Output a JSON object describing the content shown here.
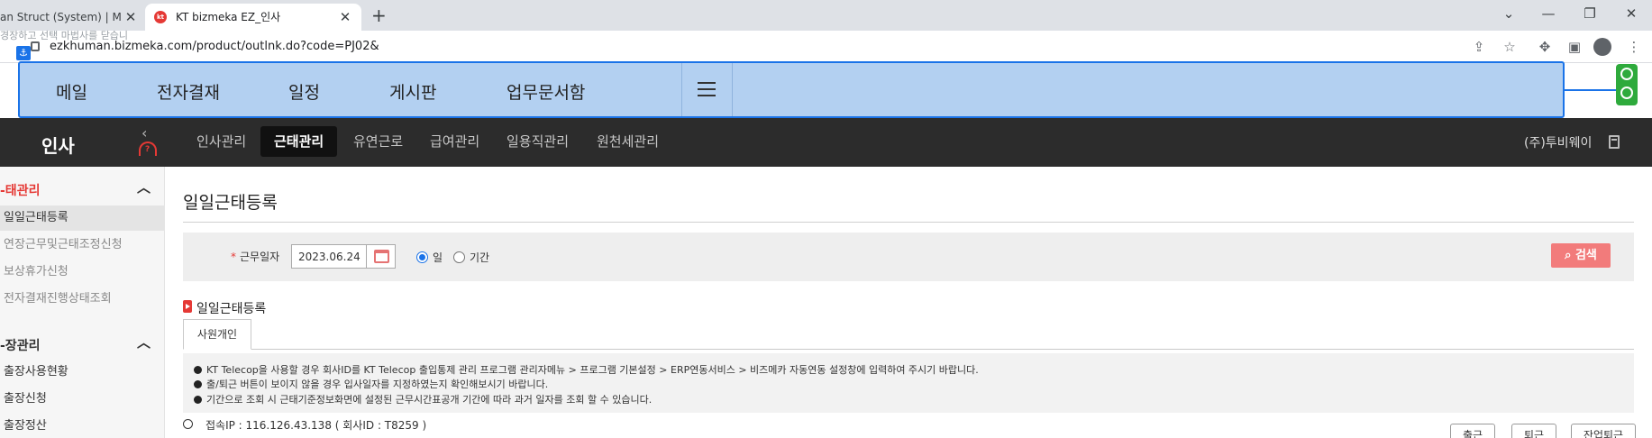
{
  "browser": {
    "tabs": [
      {
        "title": "an Struct (System) | Micr"
      },
      {
        "title": "KT bizmeka EZ_인사"
      }
    ],
    "new_tab": "+",
    "url": "ezkhuman.bizmeka.com/product/outlnk.do?code=PJ02&",
    "overlay_hint": "경장하고 선택 마법사를 닫습니"
  },
  "quick_menu": {
    "items": [
      "메일",
      "전자결재",
      "일정",
      "게시판",
      "업무문서함"
    ]
  },
  "app_header": {
    "title": "인사",
    "nav": [
      "인사관리",
      "근태관리",
      "유연근로",
      "급여관리",
      "일용직관리",
      "원천세관리"
    ],
    "active_nav": "근태관리",
    "company": "(주)투비웨이"
  },
  "sidebar": {
    "section1": "-태관리",
    "section1_items": [
      "일일근태등록",
      "연장근무및근태조정신청",
      "보상휴가신청",
      "전자결재진행상태조회"
    ],
    "section2": "-장관리",
    "section2_items": [
      "출장사용현황",
      "출장신청",
      "출장정산"
    ]
  },
  "main": {
    "page_title": "일일근태등록",
    "search": {
      "required_star": "*",
      "date_label": "근무일자",
      "date_value": "2023.06.24",
      "radio_day": "일",
      "radio_period": "기간",
      "search_button": "검색"
    },
    "section_title": "일일근태등록",
    "tab_label": "사원개인",
    "notices": [
      "KT Telecop을 사용할 경우 회사ID를 KT Telecop 출입통제 관리 프로그램 관리자메뉴 > 프로그램 기본설정 > ERP연동서비스 > 비즈메카 자동연동 설정창에 입력하여 주시기 바랍니다.",
      "출/퇴근 버튼이 보이지 않을 경우 입사일자를 지정하였는지 확인해보시기 바랍니다.",
      "기간으로 조회 시 근태기준정보화면에 설정된 근무시간표공개 기간에 따라 과거 일자를 조회 할 수 있습니다."
    ],
    "connection_info": "접속IP : 116.126.43.138 ( 회사ID : T8259 )",
    "buttons": [
      "출근",
      "퇴근",
      "잔업퇴근"
    ]
  }
}
